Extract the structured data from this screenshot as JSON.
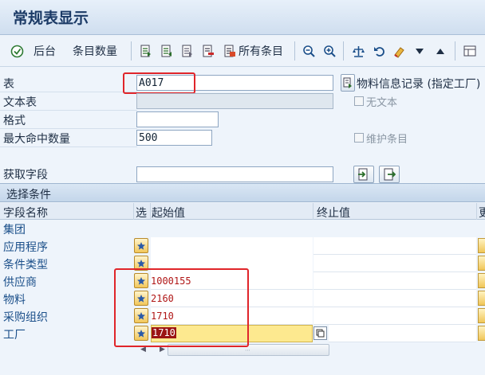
{
  "window": {
    "title": "常规表显示"
  },
  "toolbar": {
    "back_label": "后台",
    "count_label": "条目数量",
    "all_entries_label": "所有条目"
  },
  "form": {
    "table_label": "表",
    "table_value": "A017",
    "text_table_label": "文本表",
    "text_table_value": "",
    "format_label": "格式",
    "format_value": "",
    "max_hits_label": "最大命中数量",
    "max_hits_value": "500",
    "get_fields_label": "获取字段",
    "get_fields_value": "",
    "info_record_button": "物料信息记录 (指定工厂)",
    "no_text_label": "无文本",
    "maintain_entries_label": "维护条目"
  },
  "selection": {
    "header": "选择条件",
    "columns": {
      "field_name": "字段名称",
      "select": "选",
      "from": "起始值",
      "to": "终止值",
      "more": "更"
    },
    "rows": [
      {
        "name": "集团",
        "from": ""
      },
      {
        "name": "应用程序",
        "from": ""
      },
      {
        "name": "条件类型",
        "from": ""
      },
      {
        "name": "供应商",
        "from": "1000155"
      },
      {
        "name": "物料",
        "from": "2160"
      },
      {
        "name": "采购组织",
        "from": "1710"
      },
      {
        "name": "工厂",
        "from": "1710"
      }
    ]
  },
  "colors": {
    "highlight": "#e0252a",
    "active_cell": "#fde98f",
    "value_text": "#b01717"
  }
}
